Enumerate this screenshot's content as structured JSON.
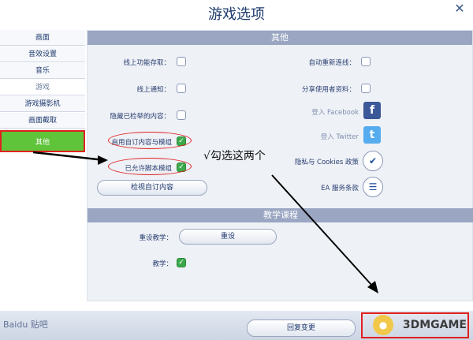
{
  "window": {
    "title": "游戏选项",
    "close_glyph": "✕"
  },
  "sidebar": {
    "items": [
      {
        "label": "画面",
        "state": "normal"
      },
      {
        "label": "音效设置",
        "state": "normal"
      },
      {
        "label": "音乐",
        "state": "normal"
      },
      {
        "label": "游戏",
        "state": "inactive"
      },
      {
        "label": "游戏摄影机",
        "state": "normal"
      },
      {
        "label": "画面截取",
        "state": "normal"
      },
      {
        "label": "其他",
        "state": "active"
      }
    ]
  },
  "other_section": {
    "header": "其他",
    "left_options": [
      {
        "label": "线上功能存取：",
        "checked": false
      },
      {
        "label": "线上通知：",
        "checked": false
      },
      {
        "label": "隐藏已检举的内容：",
        "checked": false
      },
      {
        "label": "启用自订内容与模组",
        "checked": true
      },
      {
        "label": "已允许脚本模组",
        "checked": true
      }
    ],
    "view_custom_button": "检视自订内容",
    "right_options": [
      {
        "label": "自动重新连线：",
        "checked": false
      },
      {
        "label": "分享使用者资料：",
        "checked": false
      }
    ],
    "login_facebook": "登入 Facebook",
    "login_twitter": "登入 Twitter",
    "privacy_label": "隐私与 Cookies 政策",
    "ea_terms_label": "EA 服务条款",
    "facebook_glyph": "f",
    "twitter_glyph": "t"
  },
  "tutorial_section": {
    "header": "教学课程",
    "reset_label": "重设教学：",
    "reset_button": "重设",
    "tutorial_label": "教学：",
    "tutorial_checked": true
  },
  "annotation": {
    "text": "√勾选这两个"
  },
  "bottom": {
    "restore_button": "回复变更",
    "watermark_left": "Baidu 贴吧",
    "watermark_right": "3DMGAME"
  },
  "colors": {
    "active_tab": "#5fc43a",
    "annotation_red": "#e02020",
    "checkbox_green": "#3ca94a"
  }
}
